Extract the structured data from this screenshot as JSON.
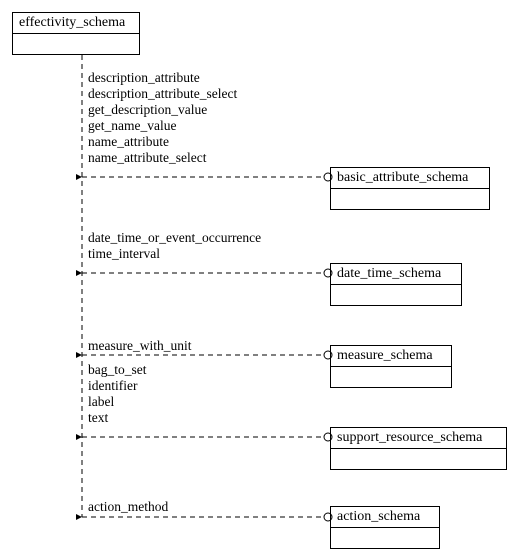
{
  "root": {
    "title": "effectivity_schema"
  },
  "targets": {
    "basic": {
      "title": "basic_attribute_schema"
    },
    "datetime": {
      "title": "date_time_schema"
    },
    "measure": {
      "title": "measure_schema"
    },
    "support": {
      "title": "support_resource_schema"
    },
    "action": {
      "title": "action_schema"
    }
  },
  "groups": {
    "g1": [
      "description_attribute",
      "description_attribute_select",
      "get_description_value",
      "get_name_value",
      "name_attribute",
      "name_attribute_select"
    ],
    "g2": [
      "date_time_or_event_occurrence",
      "time_interval"
    ],
    "g3": [
      "measure_with_unit"
    ],
    "g4": [
      "bag_to_set",
      "identifier",
      "label",
      "text"
    ],
    "g5": [
      "action_method"
    ]
  }
}
